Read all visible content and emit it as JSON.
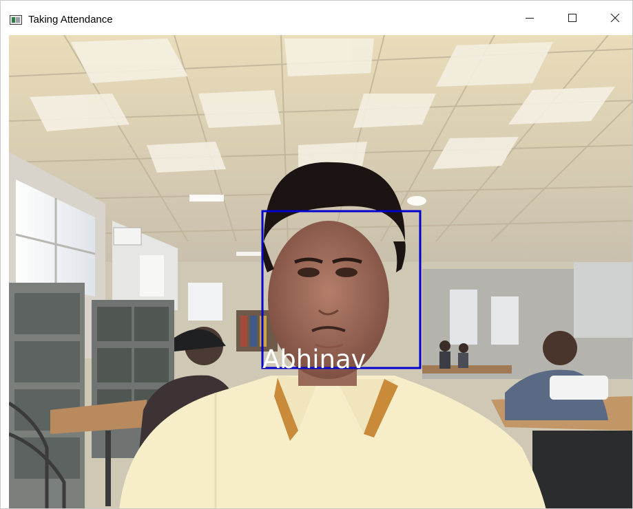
{
  "window": {
    "title": "Taking Attendance",
    "controls": {
      "minimize_icon": "minimize-icon",
      "maximize_icon": "maximize-icon",
      "close_icon": "close-icon"
    }
  },
  "camera_feed": {
    "detections": [
      {
        "label": "Abhinav",
        "box_color": "#0000cc",
        "label_color": "#ffffff"
      }
    ]
  },
  "colors": {
    "titlebar_bg": "#ffffff",
    "title_text": "#000000",
    "detection_box": "#0000cc"
  }
}
